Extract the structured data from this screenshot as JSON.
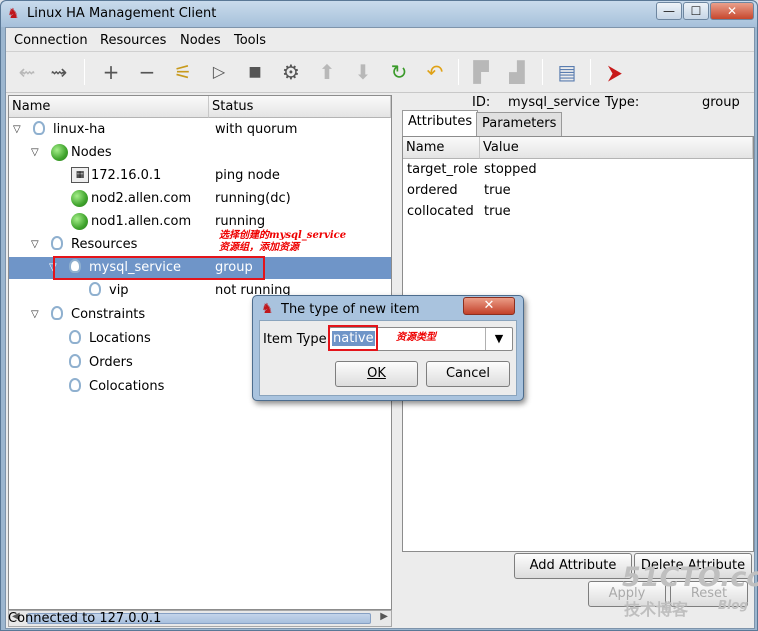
{
  "window": {
    "title": "Linux HA Management Client",
    "min": "—",
    "max": "☐",
    "close": "✕"
  },
  "menu": [
    "Connection",
    "Resources",
    "Nodes",
    "Tools"
  ],
  "tree": {
    "col_name": "Name",
    "col_status": "Status",
    "rows": [
      {
        "label": "linux-ha",
        "status": "with quorum"
      },
      {
        "label": "Nodes",
        "status": ""
      },
      {
        "label": "172.16.0.1",
        "status": "ping node"
      },
      {
        "label": "nod2.allen.com",
        "status": "running(dc)"
      },
      {
        "label": "nod1.allen.com",
        "status": "running"
      },
      {
        "label": "Resources",
        "status": ""
      },
      {
        "label": "mysql_service",
        "status": "group"
      },
      {
        "label": "vip",
        "status": "not running"
      },
      {
        "label": "Constraints",
        "status": ""
      },
      {
        "label": "Locations",
        "status": ""
      },
      {
        "label": "Orders",
        "status": ""
      },
      {
        "label": "Colocations",
        "status": ""
      }
    ]
  },
  "annotations": {
    "select_note_1": "选择创建的mysql_service",
    "select_note_2": "资源组，添加资源",
    "type_note": "资源类型"
  },
  "details": {
    "id_label": "ID:",
    "id_value": "mysql_service",
    "type_label": "Type:",
    "type_value": "group",
    "tabs": [
      "Attributes",
      "Parameters"
    ],
    "col_name": "Name",
    "col_value": "Value",
    "attributes": [
      {
        "name": "target_role",
        "value": "stopped"
      },
      {
        "name": "ordered",
        "value": "true"
      },
      {
        "name": "collocated",
        "value": "true"
      }
    ],
    "add_attribute": "Add Attribute",
    "delete_attribute": "Delete Attribute",
    "apply": "Apply",
    "reset": "Reset"
  },
  "dialog": {
    "title": "The type of new item",
    "close": "✕",
    "item_type_label": "Item Type:",
    "item_type_value": "native",
    "ok": "OK",
    "cancel": "Cancel"
  },
  "status_bar": "Connected to 127.0.0.1",
  "watermark": {
    "line1": "51CTO.com",
    "line2": "技术博客",
    "line3": "Blog"
  }
}
